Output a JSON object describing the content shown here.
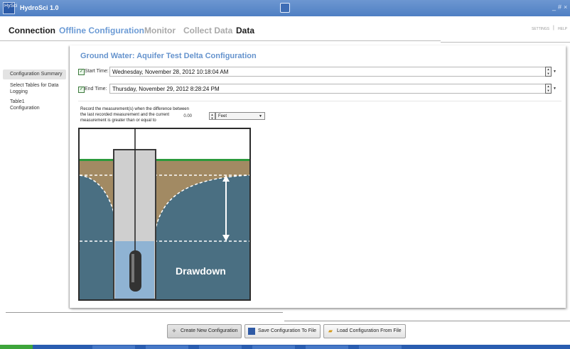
{
  "window": {
    "title": "HydroSci 1.0",
    "logo_text": "HySci",
    "controls": {
      "minimize": "_",
      "maximize": "#",
      "close": "×"
    }
  },
  "topnav": {
    "tabs": [
      "Connection",
      "Offline Configuration",
      "Monitor",
      "Collect Data",
      "Data"
    ],
    "settings": "SETTINGS",
    "separator": "|",
    "help": "HELP"
  },
  "sidebar": {
    "items": [
      "Configuration Summary",
      "Select Tables for Data Logging",
      "Table1 Configuration"
    ]
  },
  "config": {
    "title": "Ground Water: Aquifer Test Delta Configuration",
    "start": {
      "label": "Start Time:",
      "checked": "✓",
      "value": "Wednesday, November 28, 2012 10:18:04 AM"
    },
    "end": {
      "label": "End Time:",
      "checked": "✓",
      "value": "Thursday, November 29, 2012 8:28:24 PM"
    },
    "record_text": "Record the measurement(s) when the difference between the last recorded measurement and the current measurement is greater than or equal to",
    "threshold_value": "0.00",
    "unit": "Feet"
  },
  "illustration": {
    "caption": "Drawdown"
  },
  "footer": {
    "buttons": [
      "Create New Configuration",
      "Save Configuration To File",
      "Load Configuration From File"
    ]
  },
  "colors": {
    "accent": "#6593cd",
    "titlebar": "#5d8ccb",
    "grass": "#2c9a3c",
    "water": "#4a6f82"
  },
  "icons": {
    "app": "hydrosci-logo-icon",
    "center": "calculator-icon",
    "new": "new-configuration-icon",
    "save": "floppy-disk-icon",
    "load": "open-folder-icon"
  }
}
